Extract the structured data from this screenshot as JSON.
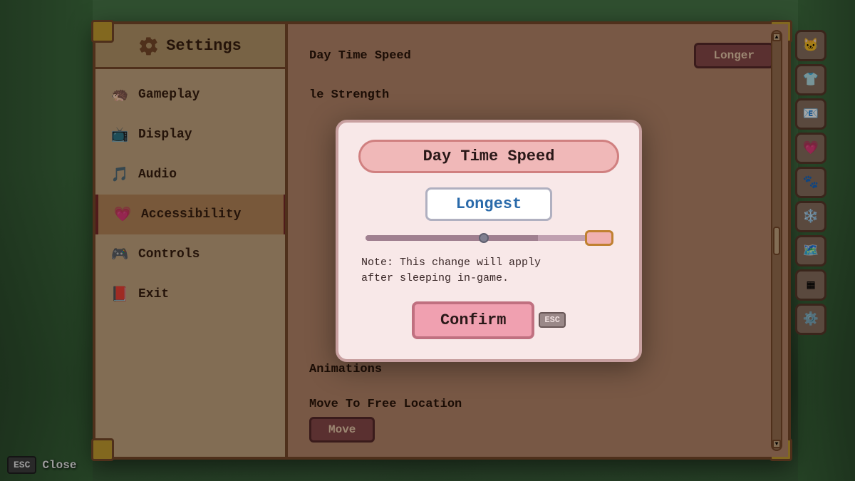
{
  "app": {
    "title": "Settings"
  },
  "sidebar": {
    "title": "Settings",
    "items": [
      {
        "id": "gameplay",
        "label": "Gameplay",
        "icon": "🦔"
      },
      {
        "id": "display",
        "label": "Display",
        "icon": "📺"
      },
      {
        "id": "audio",
        "label": "Audio",
        "icon": "🎵"
      },
      {
        "id": "accessibility",
        "label": "Accessibility",
        "icon": "💗",
        "active": true
      },
      {
        "id": "controls",
        "label": "Controls",
        "icon": "🎮"
      },
      {
        "id": "exit",
        "label": "Exit",
        "icon": "📕"
      }
    ]
  },
  "content": {
    "setting1_label": "Day Time Speed",
    "setting1_value": "Longer",
    "setting2_label": "le Strength",
    "setting3_label": "Animations",
    "move_label": "Move To Free Location",
    "move_btn": "Move"
  },
  "modal": {
    "title": "Day Time Speed",
    "value": "Longest",
    "note": "Note: This change will apply\nafter sleeping in-game.",
    "confirm_label": "Confirm",
    "esc_label": "ESC",
    "slider_percent": 70
  },
  "footer": {
    "esc_key": "ESC",
    "close_label": "Close"
  },
  "toolbar": {
    "icons": [
      "🐱",
      "👕",
      "📧",
      "💗",
      "🐾",
      "❄️",
      "🗺️",
      "▦",
      "⚙️"
    ]
  }
}
